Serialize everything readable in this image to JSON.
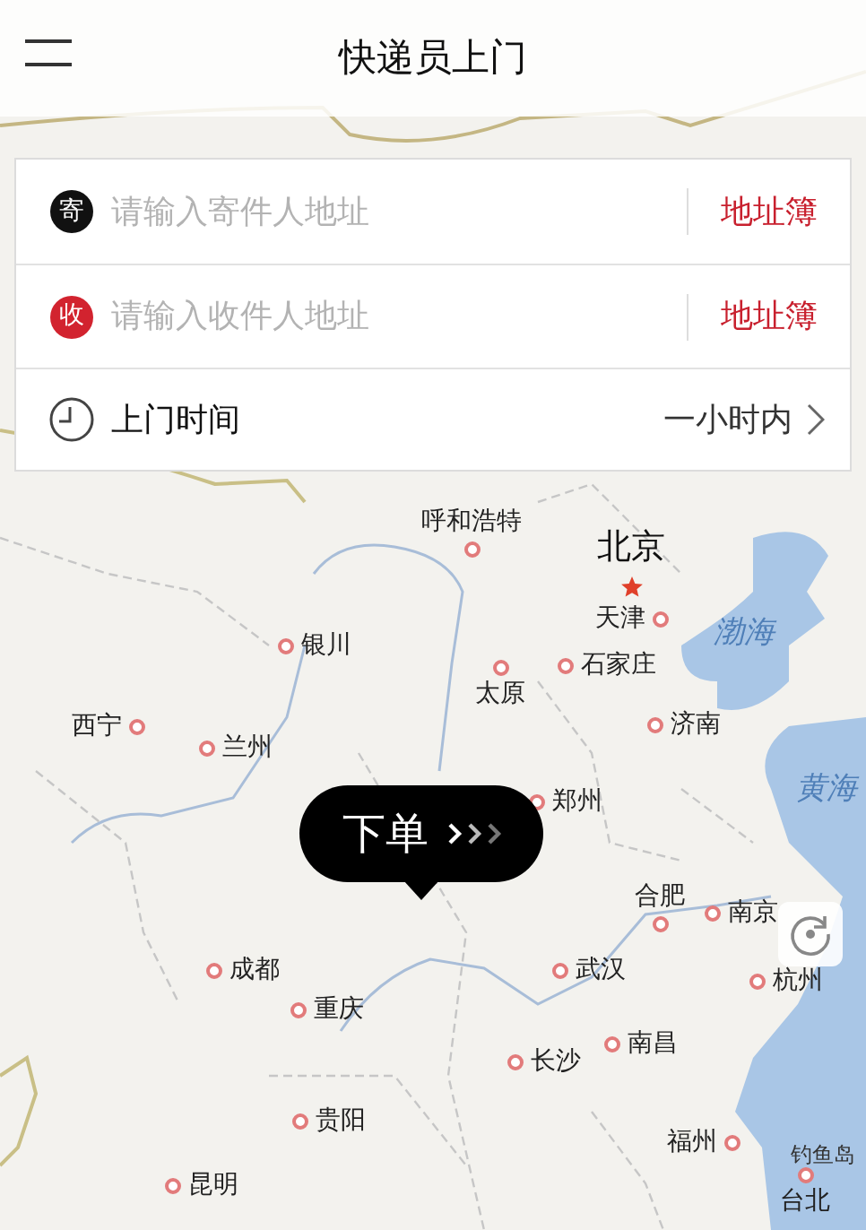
{
  "header": {
    "title": "快递员上门"
  },
  "form_rows": [
    {
      "kind": "address",
      "badge": "寄",
      "color": "#111111",
      "placeholder": "请输入寄件人地址",
      "action": "地址簿"
    },
    {
      "kind": "address",
      "badge": "收",
      "color": "#d2232f",
      "placeholder": "请输入收件人地址",
      "action": "地址簿"
    },
    {
      "kind": "time",
      "label": "上门时间",
      "value": "一小时内"
    }
  ],
  "map": {
    "labels": [
      {
        "kind": "city",
        "text": "呼和浩特"
      },
      {
        "kind": "capital",
        "text": "北京"
      },
      {
        "kind": "city",
        "text": "天津"
      },
      {
        "kind": "sea",
        "text": "渤海"
      },
      {
        "kind": "city",
        "text": "银川"
      },
      {
        "kind": "city",
        "text": "石家庄"
      },
      {
        "kind": "city",
        "text": "太原"
      },
      {
        "kind": "city",
        "text": "西宁"
      },
      {
        "kind": "city",
        "text": "兰州"
      },
      {
        "kind": "city",
        "text": "济南"
      },
      {
        "kind": "sea",
        "text": "黄海"
      },
      {
        "kind": "city",
        "text": "郑州"
      },
      {
        "kind": "city",
        "text": "合肥"
      },
      {
        "kind": "city",
        "text": "南京"
      },
      {
        "kind": "city",
        "text": "成都"
      },
      {
        "kind": "city",
        "text": "武汉"
      },
      {
        "kind": "city",
        "text": "杭州"
      },
      {
        "kind": "city",
        "text": "重庆"
      },
      {
        "kind": "city",
        "text": "南昌"
      },
      {
        "kind": "city",
        "text": "长沙"
      },
      {
        "kind": "city",
        "text": "贵阳"
      },
      {
        "kind": "city",
        "text": "福州"
      },
      {
        "kind": "island",
        "text": "钓鱼岛"
      },
      {
        "kind": "city",
        "text": "台北"
      },
      {
        "kind": "city",
        "text": "昆明"
      }
    ]
  },
  "order_button": {
    "label": "下单"
  }
}
